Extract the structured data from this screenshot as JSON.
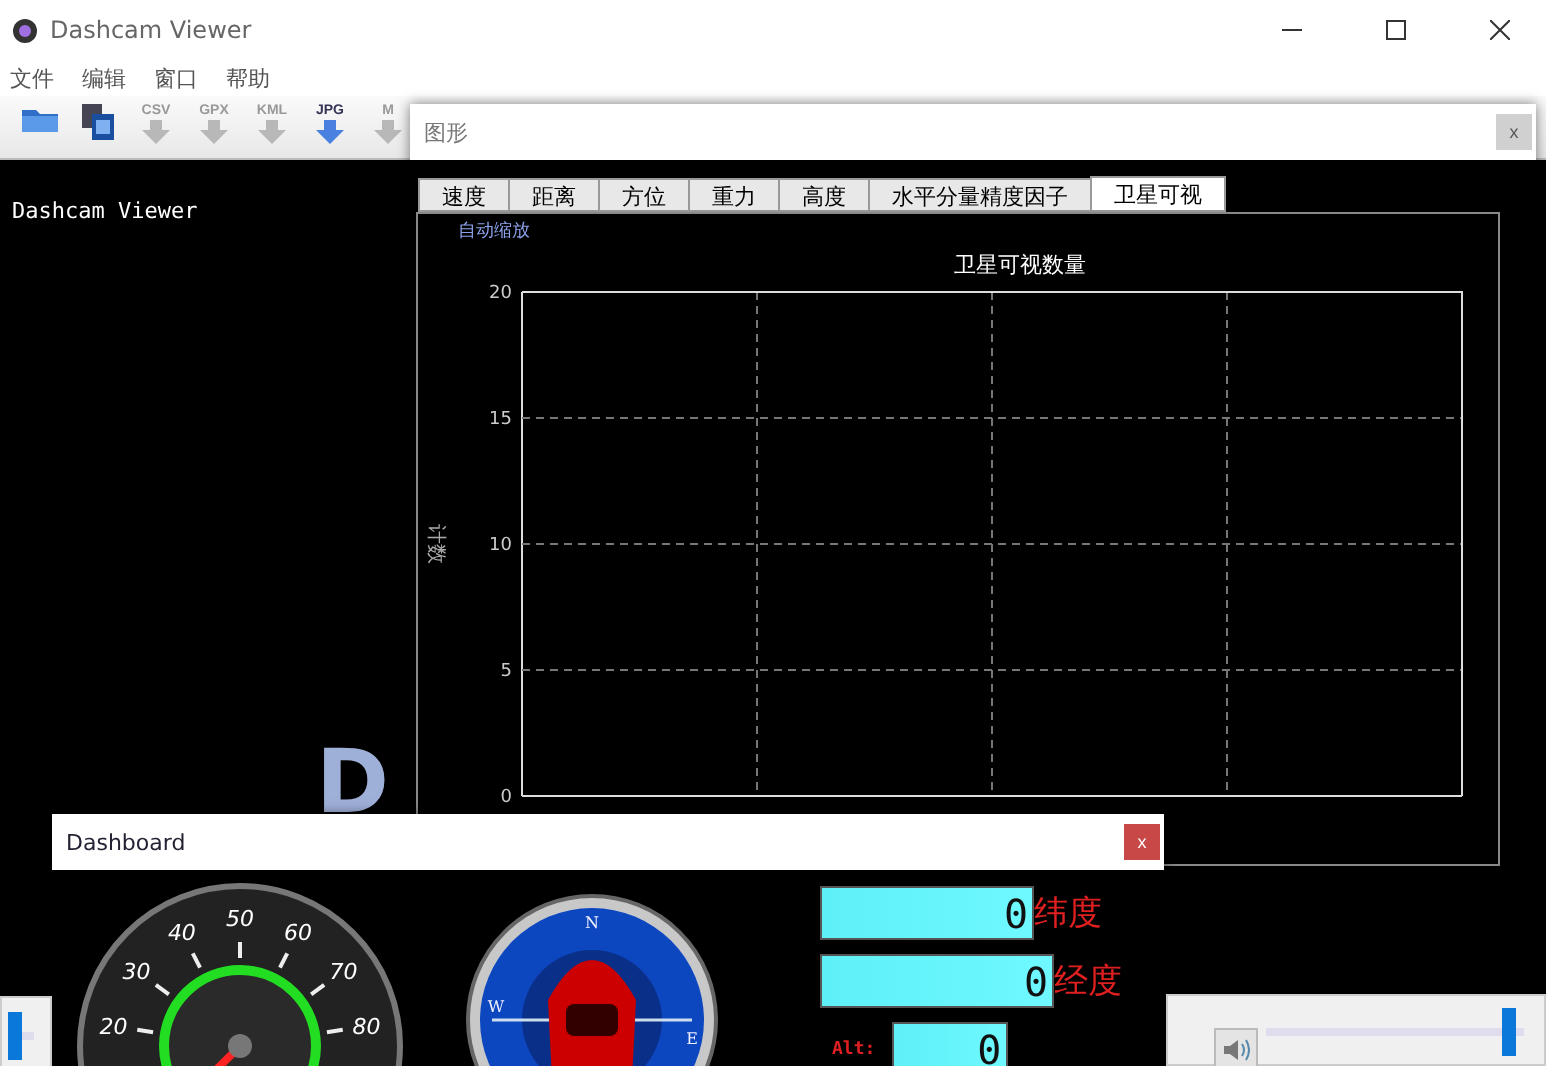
{
  "window": {
    "title": "Dashcam Viewer"
  },
  "menu": [
    "文件",
    "编辑",
    "窗口",
    "帮助"
  ],
  "toolbar": [
    {
      "kind": "folder"
    },
    {
      "kind": "film"
    },
    {
      "kind": "export",
      "label": "CSV",
      "disabled": true
    },
    {
      "kind": "export",
      "label": "GPX",
      "disabled": true
    },
    {
      "kind": "export",
      "label": "KML",
      "disabled": true
    },
    {
      "kind": "export",
      "label": "JPG",
      "disabled": false
    },
    {
      "kind": "export",
      "label": "M",
      "disabled": true
    }
  ],
  "workspace_label": "Dashcam Viewer",
  "logo_letter": "D",
  "graph_window": {
    "title": "图形",
    "close": "x",
    "tabs": [
      {
        "label": "速度",
        "selected": false
      },
      {
        "label": "距离",
        "selected": false
      },
      {
        "label": "方位",
        "selected": false
      },
      {
        "label": "重力",
        "selected": false
      },
      {
        "label": "高度",
        "selected": false
      },
      {
        "label": "水平分量精度因子",
        "selected": false
      },
      {
        "label": "卫星可视",
        "selected": true
      }
    ],
    "auto_scale": "自动缩放",
    "chart_data": {
      "type": "line",
      "title": "卫星可视数量",
      "categories": [
        null,
        null,
        null,
        null
      ],
      "grid": true,
      "ylabel": "计数",
      "ylim": [
        0,
        20
      ],
      "yticks": [
        0,
        5,
        10,
        15,
        20
      ]
    }
  },
  "dashboard": {
    "title": "Dashboard",
    "close": "x",
    "speed_labels": [
      "20",
      "30",
      "40",
      "50",
      "60",
      "70",
      "80"
    ],
    "compass_labels": [
      "N",
      "W",
      "E"
    ],
    "readouts": [
      {
        "kind": "lcd",
        "value": "0",
        "label": "纬度",
        "wide": false
      },
      {
        "kind": "lcd",
        "value": "0",
        "label": "经度",
        "wide": true
      },
      {
        "kind": "alt",
        "value": "0",
        "label": "Alt:"
      }
    ]
  },
  "seek": {
    "level": 0
  },
  "volume": {
    "level": 0.97
  }
}
